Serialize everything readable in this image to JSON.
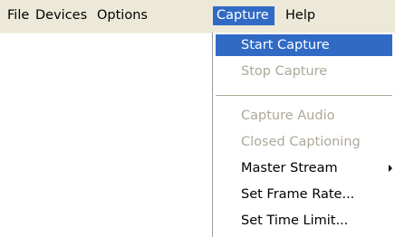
{
  "menubar": {
    "items": [
      {
        "label": "File"
      },
      {
        "label": "Devices"
      },
      {
        "label": "Options"
      },
      {
        "label": "Capture",
        "active": true
      },
      {
        "label": "Help"
      }
    ]
  },
  "capture_menu": {
    "items": [
      {
        "label": "Start Capture",
        "state": "highlighted"
      },
      {
        "label": "Stop Capture",
        "state": "disabled"
      },
      {
        "label": "Capture Audio",
        "state": "disabled"
      },
      {
        "label": "Closed Captioning",
        "state": "disabled"
      },
      {
        "label": "Master Stream",
        "state": "enabled",
        "submenu": true
      },
      {
        "label": "Set Frame Rate...",
        "state": "enabled"
      },
      {
        "label": "Set Time Limit...",
        "state": "enabled"
      }
    ]
  },
  "colors": {
    "menubar_background": "#ece9d8",
    "highlight": "#316ac5",
    "disabled_text": "#aca899"
  },
  "icons": {
    "submenu": "chevron-right-icon"
  }
}
